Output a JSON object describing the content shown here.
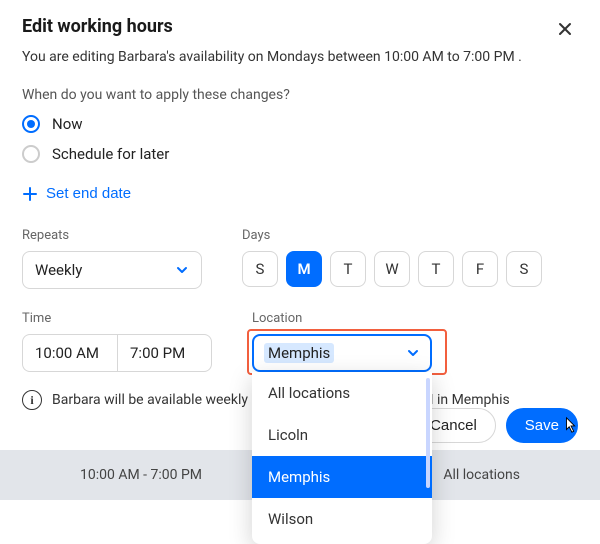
{
  "header": {
    "title": "Edit working hours",
    "subtitle": "You are editing Barbara's availability on Mondays between 10:00 AM to 7:00 PM ."
  },
  "apply": {
    "prompt": "When do you want to apply these changes?",
    "options": {
      "now": "Now",
      "schedule": "Schedule for later"
    },
    "selected": "now",
    "set_end_date": "Set end date"
  },
  "repeats": {
    "label": "Repeats",
    "value": "Weekly"
  },
  "days": {
    "label": "Days",
    "items": [
      {
        "abbr": "S",
        "active": false
      },
      {
        "abbr": "M",
        "active": true
      },
      {
        "abbr": "T",
        "active": false
      },
      {
        "abbr": "W",
        "active": false
      },
      {
        "abbr": "T",
        "active": false
      },
      {
        "abbr": "F",
        "active": false
      },
      {
        "abbr": "S",
        "active": false
      }
    ]
  },
  "time": {
    "label": "Time",
    "start": "10:00 AM",
    "end": "7:00 PM"
  },
  "location": {
    "label": "Location",
    "value": "Memphis",
    "options": [
      "All locations",
      "Licoln",
      "Memphis",
      "Wilson"
    ]
  },
  "info": {
    "text_before": "Barbara will be available weekly",
    "text_after": "to 7:00 PM in Memphis"
  },
  "actions": {
    "cancel": "Cancel",
    "save": "Save"
  },
  "footer": {
    "range": "10:00 AM - 7:00 PM",
    "scope": "All locations"
  }
}
